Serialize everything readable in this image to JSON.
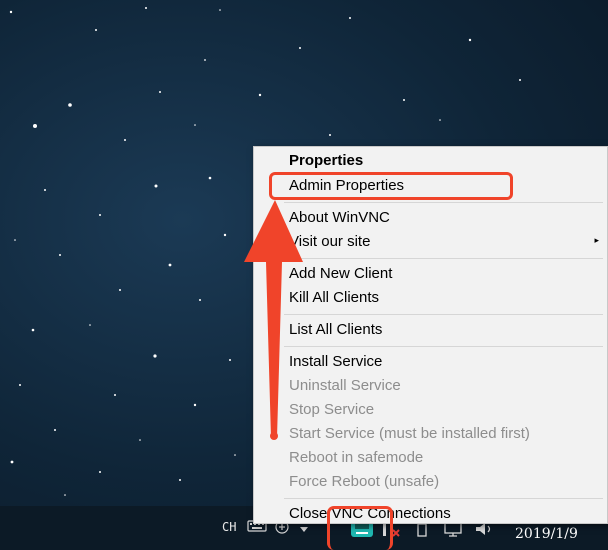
{
  "menu": {
    "items": [
      {
        "label": "Properties",
        "style": "bold",
        "enabled": true
      },
      {
        "label": "Admin Properties",
        "style": "normal",
        "enabled": true
      },
      {
        "label": "About WinVNC",
        "style": "normal",
        "enabled": true
      },
      {
        "label": "Visit our site",
        "style": "normal",
        "enabled": true,
        "submenu": true
      },
      {
        "label": "Add New Client",
        "style": "normal",
        "enabled": true
      },
      {
        "label": "Kill All Clients",
        "style": "normal",
        "enabled": true
      },
      {
        "label": "List All Clients",
        "style": "normal",
        "enabled": true
      },
      {
        "label": "Install Service",
        "style": "normal",
        "enabled": true
      },
      {
        "label": "Uninstall Service",
        "style": "normal",
        "enabled": false
      },
      {
        "label": "Stop Service",
        "style": "normal",
        "enabled": false
      },
      {
        "label": "Start Service (must be installed first)",
        "style": "normal",
        "enabled": false
      },
      {
        "label": "Reboot in safemode",
        "style": "normal",
        "enabled": false
      },
      {
        "label": "Force Reboot (unsafe)",
        "style": "normal",
        "enabled": false
      },
      {
        "label": "Close VNC Connections",
        "style": "normal",
        "enabled": true
      }
    ],
    "submenu_glyph": "▸"
  },
  "taskbar": {
    "input_language": "CH",
    "date": "2019/1/9",
    "icons": [
      "keyboard-icon",
      "ime-icon",
      "tray-expand-icon",
      "vnc-tray-icon",
      "network-error-icon",
      "battery-icon",
      "display-icon",
      "volume-icon"
    ]
  },
  "annotation_color": "#f0442a"
}
